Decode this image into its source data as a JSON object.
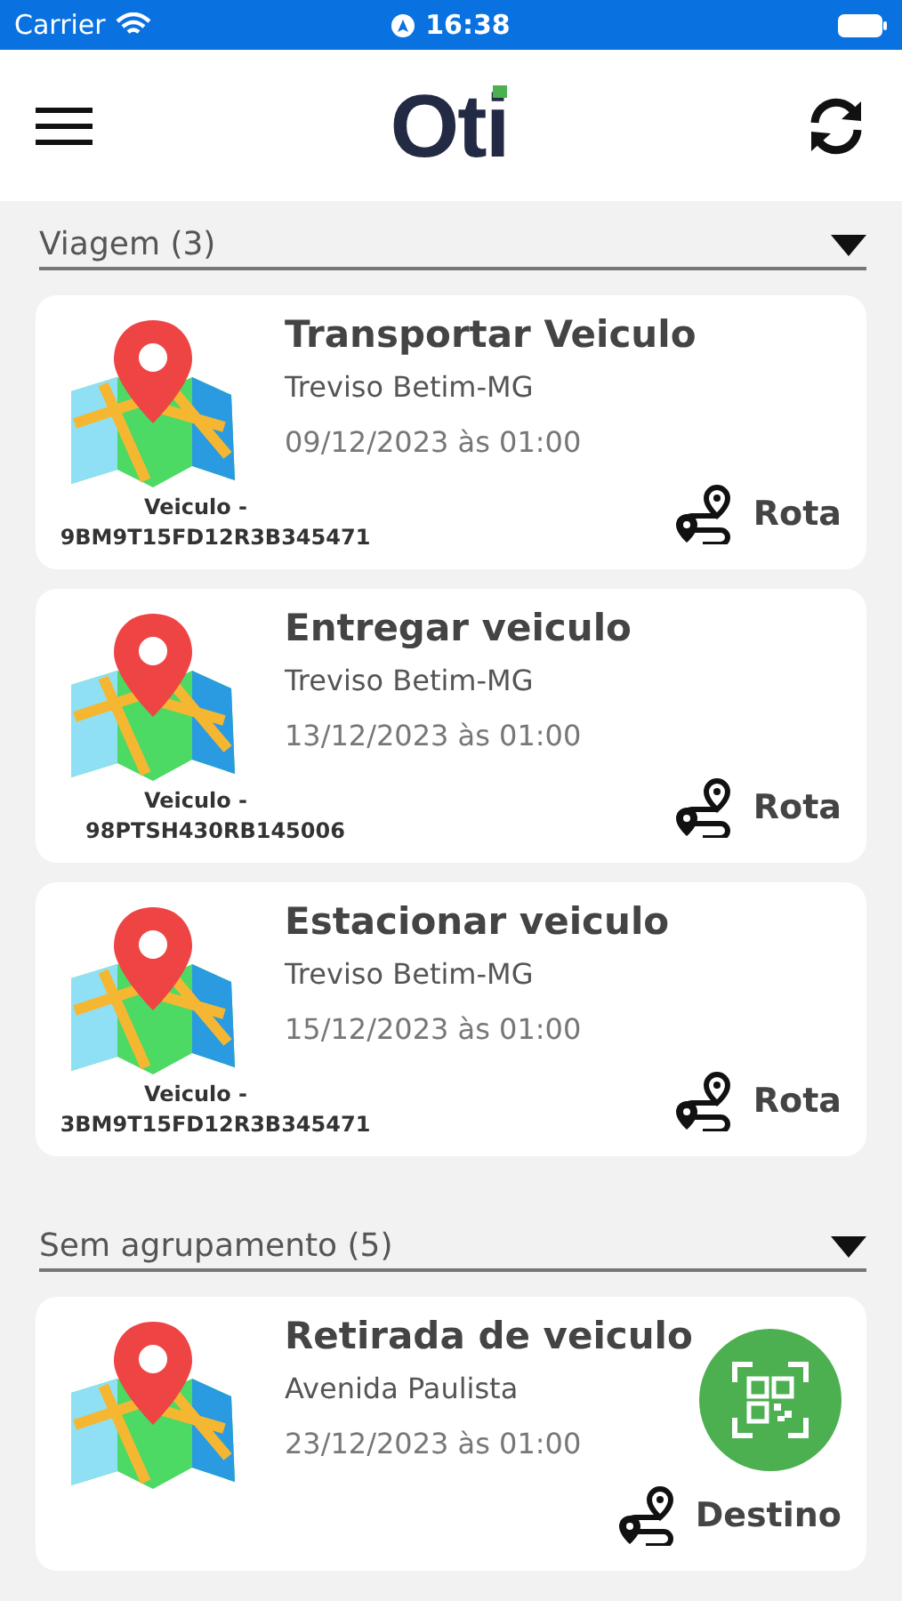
{
  "status_bar": {
    "carrier": "Carrier",
    "time": "16:38"
  },
  "header": {
    "logo": "Oti"
  },
  "groups": [
    {
      "title": "Viagem (3)",
      "expanded": true,
      "cards": [
        {
          "title": "Transportar Veiculo",
          "place": "Treviso Betim-MG",
          "date": "09/12/2023 às 01:00",
          "vehicle_label": "Veiculo -",
          "vehicle_id": "9BM9T15FD12R3B345471",
          "action": "Rota"
        },
        {
          "title": "Entregar veiculo",
          "place": "Treviso Betim-MG",
          "date": "13/12/2023 às 01:00",
          "vehicle_label": "Veiculo -",
          "vehicle_id": "98PTSH430RB145006",
          "action": "Rota"
        },
        {
          "title": "Estacionar veiculo",
          "place": "Treviso Betim-MG",
          "date": "15/12/2023 às 01:00",
          "vehicle_label": "Veiculo -",
          "vehicle_id": "3BM9T15FD12R3B345471",
          "action": "Rota"
        }
      ]
    },
    {
      "title": "Sem agrupamento (5)",
      "expanded": true,
      "cards": [
        {
          "title": "Retirada de veiculo",
          "place": "Avenida Paulista",
          "date": "23/12/2023 às 01:00",
          "action": "Destino"
        }
      ]
    }
  ]
}
